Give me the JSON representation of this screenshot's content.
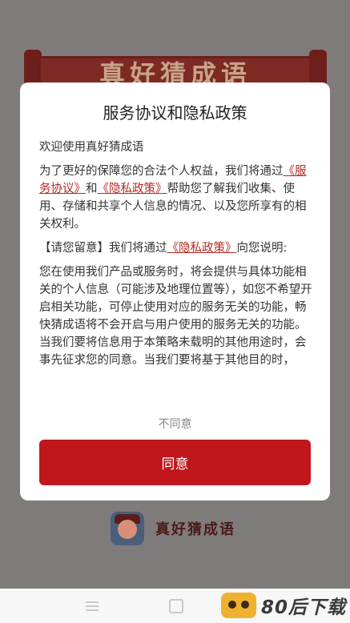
{
  "background": {
    "banner_title": "真好猜成语",
    "app_name": "真好猜成语"
  },
  "modal": {
    "title": "服务协议和隐私政策",
    "greeting": "欢迎使用真好猜成语",
    "p1_a": "为了更好的保障您的合法个人权益，我们将通过",
    "service_link": "《服务协议》",
    "and_text": "和",
    "privacy_link": "《隐私政策》",
    "p1_b": "帮助您了解我们收集、使用、存储和共享个人信息的情况、以及您所享有的相关权利。",
    "p2_a": "【请您留意】我们将通过",
    "privacy_link_2": "《隐私政策》",
    "p2_b": "向您说明:",
    "p3": "您在使用我们产品或服务时，将会提供与具体功能相关的个人信息（可能涉及地理位置等），如您不希望开启相关功能，可停止使用对应的服务无关的功能，畅快猜成语将不会开启与用户使用的服务无关的功能。当我们要将信息用于本策略未载明的其他用途时，会事先征求您的同意。当我们要将基于其他目的时，",
    "disagree_label": "不同意",
    "agree_label": "同意"
  },
  "watermark": {
    "text": "80后下载"
  },
  "colors": {
    "accent": "#c0161c",
    "link": "#b52a22"
  }
}
